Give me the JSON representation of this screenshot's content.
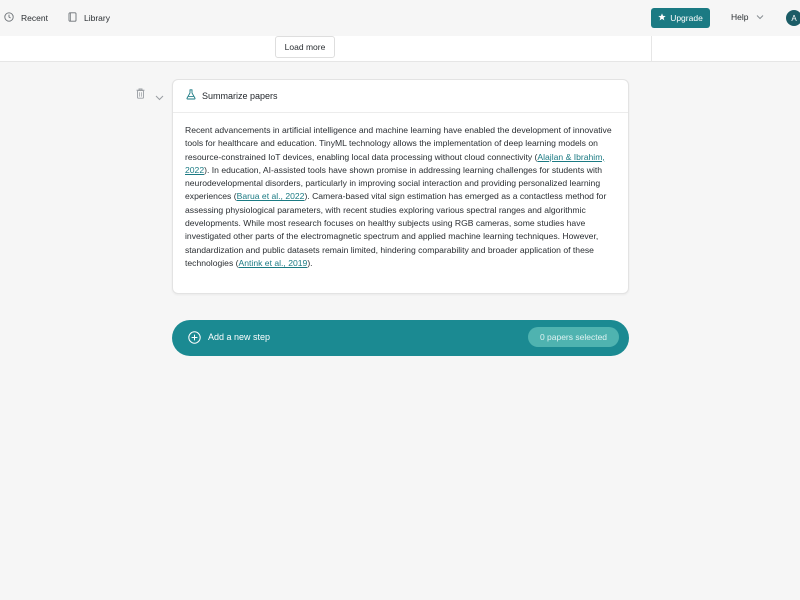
{
  "topbar": {
    "recent_label": "Recent",
    "library_label": "Library",
    "upgrade_label": "Upgrade",
    "help_label": "Help",
    "avatar_initial": "A"
  },
  "history": {
    "load_more_label": "Load more"
  },
  "step": {
    "title": "Summarize papers",
    "body": [
      {
        "type": "text",
        "value": "Recent advancements in artificial intelligence and machine learning have enabled the development of innovative tools for healthcare and education. TinyML technology allows the implementation of deep learning models on resource-constrained IoT devices, enabling local data processing without cloud connectivity ("
      },
      {
        "type": "cite",
        "value": "Alajlan & Ibrahim, 2022"
      },
      {
        "type": "text",
        "value": "). In education, AI-assisted tools have shown promise in addressing learning challenges for students with neurodevelopmental disorders, particularly in improving social interaction and providing personalized learning experiences ("
      },
      {
        "type": "cite",
        "value": "Barua et al., 2022"
      },
      {
        "type": "text",
        "value": "). Camera-based vital sign estimation has emerged as a contactless method for assessing physiological parameters, with recent studies exploring various spectral ranges and algorithmic developments. While most research focuses on healthy subjects using RGB cameras, some studies have investigated other parts of the electromagnetic spectrum and applied machine learning techniques. However, standardization and public datasets remain limited, hindering comparability and broader application of these technologies ("
      },
      {
        "type": "cite",
        "value": "Antink et al., 2019"
      },
      {
        "type": "text",
        "value": ")."
      }
    ]
  },
  "add_step": {
    "label": "Add a new step",
    "papers_selected": "0 papers selected"
  },
  "colors": {
    "accent": "#1b7a83",
    "pill": "#1b8a92",
    "badge": "#4fb3b0"
  }
}
